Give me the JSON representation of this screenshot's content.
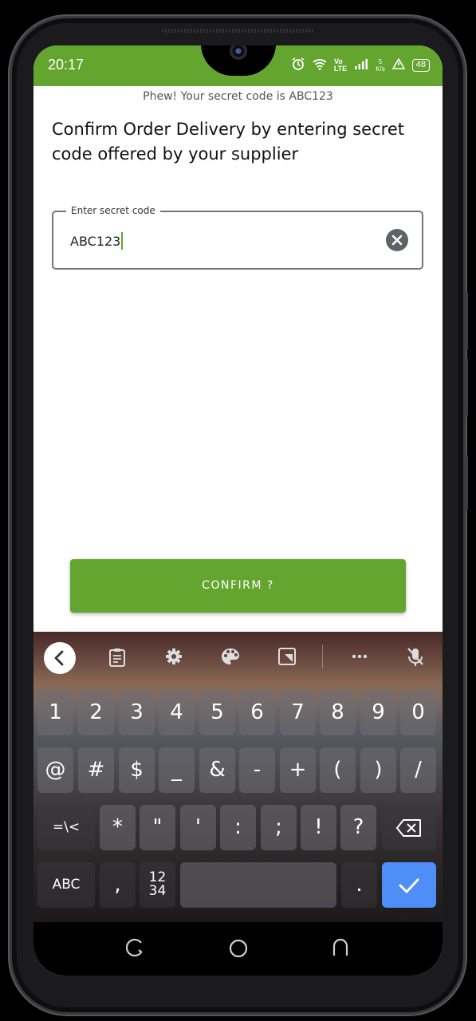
{
  "status_bar": {
    "time": "20:17",
    "net_type": "LTE",
    "net_vo": "Vo",
    "speed": "5",
    "speed_unit": "K/s",
    "battery": "48"
  },
  "screen": {
    "banner": "Phew! Your secret code is ABC123",
    "heading": "Confirm Order Delivery by entering secret code offered by your supplier",
    "field": {
      "label": "Enter secret code",
      "value": "ABC123"
    },
    "confirm_label": "CONFIRM ?",
    "accent_color": "#64a530"
  },
  "keyboard": {
    "toolbar_icons": [
      "back-icon",
      "clipboard-icon",
      "settings-icon",
      "palette-icon",
      "resize-icon",
      "more-icon",
      "mic-off-icon"
    ],
    "row1": [
      "1",
      "2",
      "3",
      "4",
      "5",
      "6",
      "7",
      "8",
      "9",
      "0"
    ],
    "row2": [
      "@",
      "#",
      "$",
      "_",
      "&",
      "-",
      "+",
      "(",
      ")",
      "/"
    ],
    "row3": [
      "=\\<",
      "*",
      "\"",
      "'",
      ":",
      ";",
      "!",
      "?"
    ],
    "abc_label": "ABC",
    "comma": ",",
    "numpad_label_top": "12",
    "numpad_label_bottom": "34",
    "period": "."
  },
  "nav_bar": {
    "icons": [
      "recents-icon",
      "home-icon",
      "back-icon"
    ]
  }
}
